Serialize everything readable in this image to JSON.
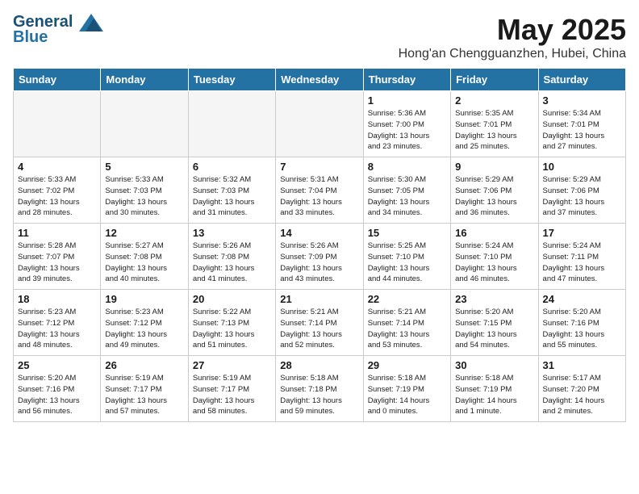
{
  "header": {
    "logo_line1": "General",
    "logo_line2": "Blue",
    "month_title": "May 2025",
    "location": "Hong'an Chengguanzhen, Hubei, China"
  },
  "weekdays": [
    "Sunday",
    "Monday",
    "Tuesday",
    "Wednesday",
    "Thursday",
    "Friday",
    "Saturday"
  ],
  "weeks": [
    [
      {
        "day": "",
        "info": ""
      },
      {
        "day": "",
        "info": ""
      },
      {
        "day": "",
        "info": ""
      },
      {
        "day": "",
        "info": ""
      },
      {
        "day": "1",
        "info": "Sunrise: 5:36 AM\nSunset: 7:00 PM\nDaylight: 13 hours\nand 23 minutes."
      },
      {
        "day": "2",
        "info": "Sunrise: 5:35 AM\nSunset: 7:01 PM\nDaylight: 13 hours\nand 25 minutes."
      },
      {
        "day": "3",
        "info": "Sunrise: 5:34 AM\nSunset: 7:01 PM\nDaylight: 13 hours\nand 27 minutes."
      }
    ],
    [
      {
        "day": "4",
        "info": "Sunrise: 5:33 AM\nSunset: 7:02 PM\nDaylight: 13 hours\nand 28 minutes."
      },
      {
        "day": "5",
        "info": "Sunrise: 5:33 AM\nSunset: 7:03 PM\nDaylight: 13 hours\nand 30 minutes."
      },
      {
        "day": "6",
        "info": "Sunrise: 5:32 AM\nSunset: 7:03 PM\nDaylight: 13 hours\nand 31 minutes."
      },
      {
        "day": "7",
        "info": "Sunrise: 5:31 AM\nSunset: 7:04 PM\nDaylight: 13 hours\nand 33 minutes."
      },
      {
        "day": "8",
        "info": "Sunrise: 5:30 AM\nSunset: 7:05 PM\nDaylight: 13 hours\nand 34 minutes."
      },
      {
        "day": "9",
        "info": "Sunrise: 5:29 AM\nSunset: 7:06 PM\nDaylight: 13 hours\nand 36 minutes."
      },
      {
        "day": "10",
        "info": "Sunrise: 5:29 AM\nSunset: 7:06 PM\nDaylight: 13 hours\nand 37 minutes."
      }
    ],
    [
      {
        "day": "11",
        "info": "Sunrise: 5:28 AM\nSunset: 7:07 PM\nDaylight: 13 hours\nand 39 minutes."
      },
      {
        "day": "12",
        "info": "Sunrise: 5:27 AM\nSunset: 7:08 PM\nDaylight: 13 hours\nand 40 minutes."
      },
      {
        "day": "13",
        "info": "Sunrise: 5:26 AM\nSunset: 7:08 PM\nDaylight: 13 hours\nand 41 minutes."
      },
      {
        "day": "14",
        "info": "Sunrise: 5:26 AM\nSunset: 7:09 PM\nDaylight: 13 hours\nand 43 minutes."
      },
      {
        "day": "15",
        "info": "Sunrise: 5:25 AM\nSunset: 7:10 PM\nDaylight: 13 hours\nand 44 minutes."
      },
      {
        "day": "16",
        "info": "Sunrise: 5:24 AM\nSunset: 7:10 PM\nDaylight: 13 hours\nand 46 minutes."
      },
      {
        "day": "17",
        "info": "Sunrise: 5:24 AM\nSunset: 7:11 PM\nDaylight: 13 hours\nand 47 minutes."
      }
    ],
    [
      {
        "day": "18",
        "info": "Sunrise: 5:23 AM\nSunset: 7:12 PM\nDaylight: 13 hours\nand 48 minutes."
      },
      {
        "day": "19",
        "info": "Sunrise: 5:23 AM\nSunset: 7:12 PM\nDaylight: 13 hours\nand 49 minutes."
      },
      {
        "day": "20",
        "info": "Sunrise: 5:22 AM\nSunset: 7:13 PM\nDaylight: 13 hours\nand 51 minutes."
      },
      {
        "day": "21",
        "info": "Sunrise: 5:21 AM\nSunset: 7:14 PM\nDaylight: 13 hours\nand 52 minutes."
      },
      {
        "day": "22",
        "info": "Sunrise: 5:21 AM\nSunset: 7:14 PM\nDaylight: 13 hours\nand 53 minutes."
      },
      {
        "day": "23",
        "info": "Sunrise: 5:20 AM\nSunset: 7:15 PM\nDaylight: 13 hours\nand 54 minutes."
      },
      {
        "day": "24",
        "info": "Sunrise: 5:20 AM\nSunset: 7:16 PM\nDaylight: 13 hours\nand 55 minutes."
      }
    ],
    [
      {
        "day": "25",
        "info": "Sunrise: 5:20 AM\nSunset: 7:16 PM\nDaylight: 13 hours\nand 56 minutes."
      },
      {
        "day": "26",
        "info": "Sunrise: 5:19 AM\nSunset: 7:17 PM\nDaylight: 13 hours\nand 57 minutes."
      },
      {
        "day": "27",
        "info": "Sunrise: 5:19 AM\nSunset: 7:17 PM\nDaylight: 13 hours\nand 58 minutes."
      },
      {
        "day": "28",
        "info": "Sunrise: 5:18 AM\nSunset: 7:18 PM\nDaylight: 13 hours\nand 59 minutes."
      },
      {
        "day": "29",
        "info": "Sunrise: 5:18 AM\nSunset: 7:19 PM\nDaylight: 14 hours\nand 0 minutes."
      },
      {
        "day": "30",
        "info": "Sunrise: 5:18 AM\nSunset: 7:19 PM\nDaylight: 14 hours\nand 1 minute."
      },
      {
        "day": "31",
        "info": "Sunrise: 5:17 AM\nSunset: 7:20 PM\nDaylight: 14 hours\nand 2 minutes."
      }
    ]
  ]
}
